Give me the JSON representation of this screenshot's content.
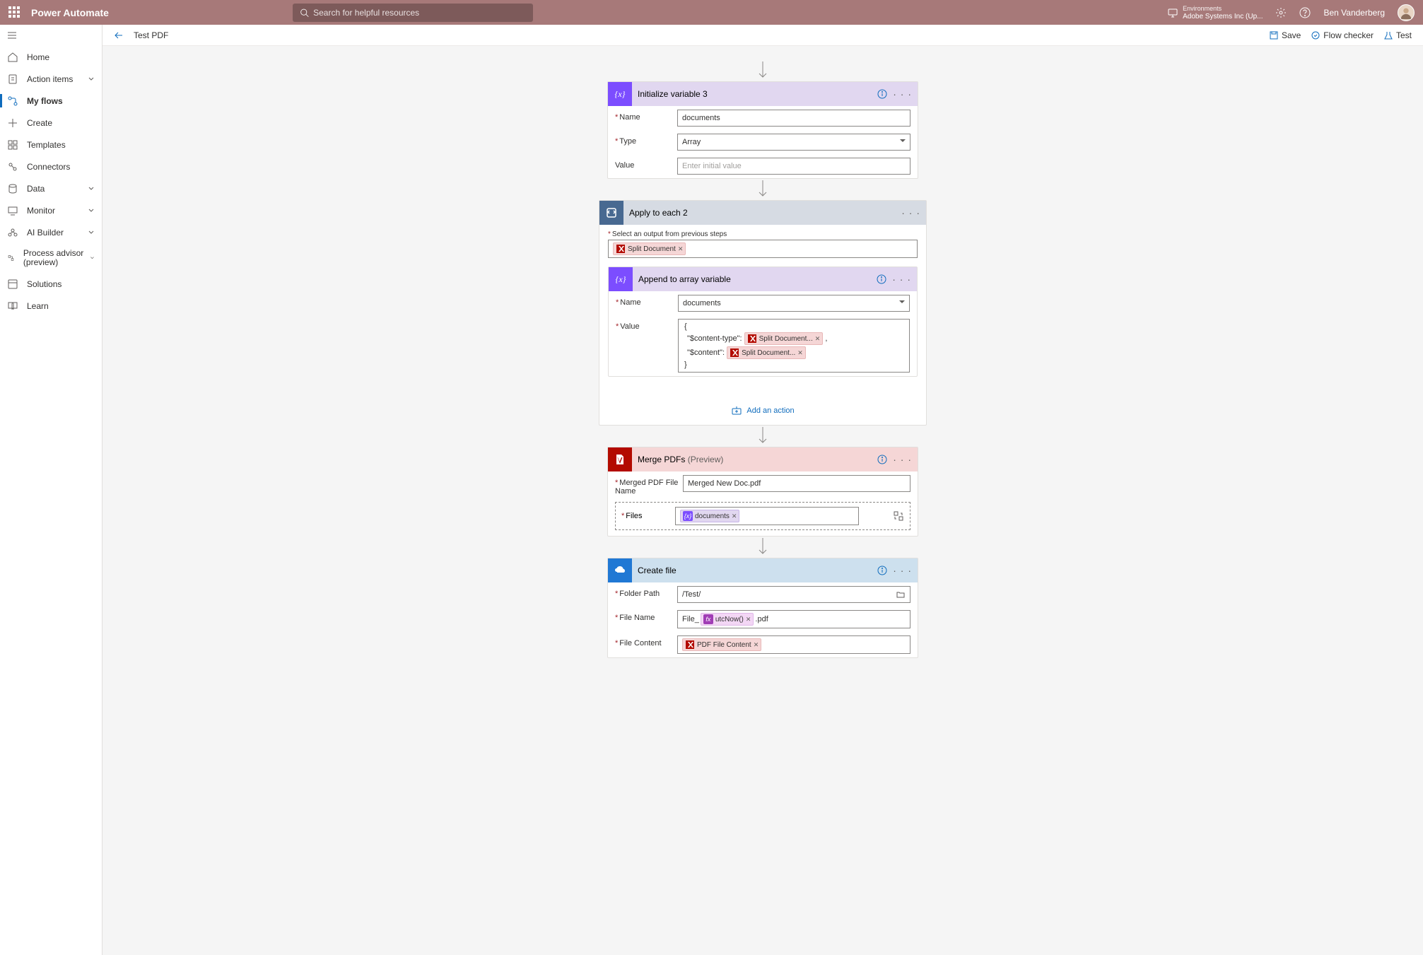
{
  "header": {
    "brand": "Power Automate",
    "search_placeholder": "Search for helpful resources",
    "env_label": "Environments",
    "env_value": "Adobe Systems Inc (Up...",
    "user": "Ben Vanderberg"
  },
  "nav": {
    "home": "Home",
    "action_items": "Action items",
    "my_flows": "My flows",
    "create": "Create",
    "templates": "Templates",
    "connectors": "Connectors",
    "data": "Data",
    "monitor": "Monitor",
    "ai_builder": "AI Builder",
    "process_advisor": "Process advisor (preview)",
    "solutions": "Solutions",
    "learn": "Learn"
  },
  "cmd": {
    "flow_title": "Test PDF",
    "save": "Save",
    "flow_checker": "Flow checker",
    "test": "Test"
  },
  "cards": {
    "init_var": {
      "title": "Initialize variable 3",
      "name_label": "Name",
      "name_value": "documents",
      "type_label": "Type",
      "type_value": "Array",
      "value_label": "Value",
      "value_placeholder": "Enter initial value"
    },
    "apply": {
      "title": "Apply to each 2",
      "select_label": "Select an output from previous steps",
      "token": "Split Document",
      "append": {
        "title": "Append to array variable",
        "name_label": "Name",
        "name_value": "documents",
        "value_label": "Value",
        "brace_open": "{",
        "ct_label": "\"$content-type\":",
        "token1": "Split Document...",
        "c_label": "\"$content\":",
        "token2": "Split Document...",
        "brace_close": "}"
      },
      "add_action": "Add an action"
    },
    "merge": {
      "title": "Merge PDFs",
      "preview": "(Preview)",
      "fname_label": "Merged PDF File Name",
      "fname_value": "Merged New Doc.pdf",
      "files_label": "Files",
      "files_token": "documents"
    },
    "create_file": {
      "title": "Create file",
      "folder_label": "Folder Path",
      "folder_value": "/Test/",
      "fname_label": "File Name",
      "fname_prefix": "File_",
      "fname_token": "utcNow()",
      "fname_suffix": ".pdf",
      "content_label": "File Content",
      "content_token": "PDF File Content"
    }
  }
}
